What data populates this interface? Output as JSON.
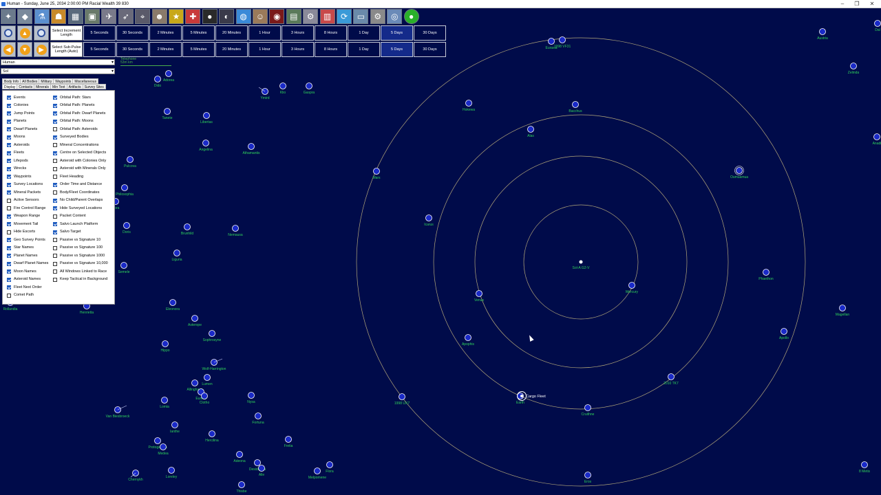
{
  "window": {
    "title": "Human - Sunday, June 25, 2034 2:00:00 PM  Racial Wealth 39 830",
    "controls": [
      "–",
      "❐",
      "✕"
    ]
  },
  "colors": {
    "background": "#000b4a",
    "orbit": "#b4a87a",
    "body_fill": "#1a2ac8",
    "body_stroke": "#ffffff",
    "label": "#2ed15a",
    "button_bg": "#000b4a",
    "button_selected": "#142a8a"
  },
  "toolbar": {
    "icons": [
      {
        "name": "galaxy-map-icon",
        "glyph": "✦"
      },
      {
        "name": "class-design-icon",
        "glyph": "◆"
      },
      {
        "name": "research-icon",
        "glyph": "⚗"
      },
      {
        "name": "population-icon",
        "glyph": "☗"
      },
      {
        "name": "industry-icon",
        "glyph": "▦"
      },
      {
        "name": "ground-forces-icon",
        "glyph": "▣"
      },
      {
        "name": "fleet-icon",
        "glyph": "✈"
      },
      {
        "name": "missile-design-icon",
        "glyph": "➶"
      },
      {
        "name": "turret-design-icon",
        "glyph": "⌖"
      },
      {
        "name": "commanders-icon",
        "glyph": "☻"
      },
      {
        "name": "medals-icon",
        "glyph": "★"
      },
      {
        "name": "race-icon",
        "glyph": "✚"
      },
      {
        "name": "system-view-icon",
        "glyph": "●"
      },
      {
        "name": "galactic-icon",
        "glyph": "◐"
      },
      {
        "name": "intelligence-icon",
        "glyph": "◍"
      },
      {
        "name": "diplomacy-icon",
        "glyph": "☺"
      },
      {
        "name": "hostiles-icon",
        "glyph": "◉"
      },
      {
        "name": "wealth-icon",
        "glyph": "▤"
      },
      {
        "name": "ship-combat-icon",
        "glyph": "⚙"
      },
      {
        "name": "events-icon",
        "glyph": "▥"
      },
      {
        "name": "refresh-icon",
        "glyph": "⟳"
      },
      {
        "name": "save-icon",
        "glyph": "▭"
      },
      {
        "name": "settings-icon",
        "glyph": "⚙"
      },
      {
        "name": "globe-icon",
        "glyph": "◎"
      },
      {
        "name": "green-status-icon",
        "glyph": "●"
      }
    ]
  },
  "time": {
    "increment_label": "Select Increment Length",
    "subpulse_label": "Select Sub-Pulse Length (Auto)",
    "buttons": [
      "5 Seconds",
      "30 Seconds",
      "2 Minutes",
      "5 Minutes",
      "20 Minutes",
      "1 Hour",
      "3 Hours",
      "8 Hours",
      "1 Day",
      "5 Days",
      "30 Days"
    ],
    "selected_increment": "5 Days"
  },
  "race_select": {
    "value": "Human"
  },
  "system_select": {
    "value": "Sol"
  },
  "scale_label": "Telephone\n53m km",
  "tabs_row1": [
    "Body Info",
    "All Bodies",
    "Military",
    "Waypoints",
    "Miscellaneous"
  ],
  "tabs_row2": [
    "Display",
    "Contacts",
    "Minerals",
    "Min Text",
    "Artifacts",
    "Survey Sites"
  ],
  "active_tab": "Display",
  "display_options_left": [
    {
      "label": "Events",
      "on": true
    },
    {
      "label": "Colonies",
      "on": true
    },
    {
      "label": "Jump Points",
      "on": true
    },
    {
      "label": "Planets",
      "on": true
    },
    {
      "label": "Dwarf Planets",
      "on": true
    },
    {
      "label": "Moons",
      "on": true
    },
    {
      "label": "Asteroids",
      "on": true
    },
    {
      "label": "Fleets",
      "on": true
    },
    {
      "label": "Lifepods",
      "on": true
    },
    {
      "label": "Wrecks",
      "on": true
    },
    {
      "label": "Waypoints",
      "on": true
    },
    {
      "label": "Survey Locations",
      "on": true
    },
    {
      "label": "Mineral Packets",
      "on": true
    },
    {
      "label": "Active Sensors",
      "on": false
    },
    {
      "label": "Fire Control Range",
      "on": false
    },
    {
      "label": "Weapon Range",
      "on": true
    },
    {
      "label": "Movement Tail",
      "on": true
    },
    {
      "label": "Hide Escorts",
      "on": false
    },
    {
      "label": "Geo Survey Points",
      "on": true
    },
    {
      "label": "Star Names",
      "on": true
    },
    {
      "label": "Planet Names",
      "on": true
    },
    {
      "label": "Dwarf Planet Names",
      "on": true
    },
    {
      "label": "Moon Names",
      "on": true
    },
    {
      "label": "Asteroid Names",
      "on": true
    },
    {
      "label": "Fleet Next Order",
      "on": true
    },
    {
      "label": "Comet Path",
      "on": false
    }
  ],
  "display_options_right": [
    {
      "label": "Orbital Path: Stars",
      "on": true
    },
    {
      "label": "Orbital Path: Planets",
      "on": true
    },
    {
      "label": "Orbital Path: Dwarf Planets",
      "on": true
    },
    {
      "label": "Orbital Path: Moons",
      "on": true
    },
    {
      "label": "Orbital Path: Asteroids",
      "on": false
    },
    {
      "label": "Surveyed Bodies",
      "on": true
    },
    {
      "label": "Mineral Concentrations",
      "on": false
    },
    {
      "label": "Centre on Selected Objects",
      "on": true
    },
    {
      "label": "Asteroid with Colonies Only",
      "on": false
    },
    {
      "label": "Asteroid with Minerals Only",
      "on": false
    },
    {
      "label": "Fleet Heading",
      "on": false
    },
    {
      "label": "Order Time and Distance",
      "on": true
    },
    {
      "label": "Body/Fleet Coordinates",
      "on": false
    },
    {
      "label": "No Child/Parent Overlaps",
      "on": true
    },
    {
      "label": "Hide Surveyed Locations",
      "on": true
    },
    {
      "label": "Packet Content",
      "on": false
    },
    {
      "label": "Salvo Launch Platform",
      "on": true
    },
    {
      "label": "Salvo Target",
      "on": true
    },
    {
      "label": "Passive vs Signature 10",
      "on": false
    },
    {
      "label": "Passive vs Signature 100",
      "on": false
    },
    {
      "label": "Passive vs Signature 1000",
      "on": false
    },
    {
      "label": "Passive vs Signature 10,000",
      "on": false
    },
    {
      "label": "All Windows Linked to Race",
      "on": false
    },
    {
      "label": "Keep Tactical in Background",
      "on": false
    }
  ],
  "star": {
    "label": "Sol-A G2-V"
  },
  "fleet": {
    "label": "Cargo Fleet"
  },
  "bodies": [
    "Adorea",
    "Dido",
    "Ymird",
    "Klio",
    "Gaspra",
    "Tanete",
    "Libertas",
    "Angelina",
    "Athamantis",
    "Pulcova",
    "Philosophia",
    "Nora",
    "Doris",
    "Brunhild",
    "Nemausa",
    "Liguria",
    "Semele",
    "Eleonora",
    "Asterope",
    "Sophrosyne",
    "Hippo",
    "Wolf-Harrington",
    "Lumen",
    "Allinghaus",
    "Eunike",
    "Clotho",
    "Lomia",
    "Nysa",
    "Fortuna",
    "Ianthe",
    "Hercilina",
    "Protogeneia",
    "Medea",
    "Fretia",
    "Adeona",
    "Desiderata",
    "Alle",
    "Flora",
    "Melpomene",
    "Loreley",
    "Chernykh",
    "Thisbe",
    "Van Biesbroeck",
    "Rollandia",
    "Henrietta",
    "Eurasia",
    "1998 VF31",
    "Bacchus",
    "Hokewa",
    "Alas",
    "Mars",
    "Icarus",
    "Venus",
    "Mercury",
    "Apophis",
    "Earth",
    "Cruithne",
    "2010 TK7",
    "1998 UX7",
    "Eros",
    "Oumuamua",
    "Phaethon",
    "Magellan",
    "Apollo",
    "Austria",
    "Zelinda",
    "Dal",
    "Anadi",
    "8 Metis"
  ],
  "cursor": {
    "icon": "arrow-cursor-icon"
  }
}
